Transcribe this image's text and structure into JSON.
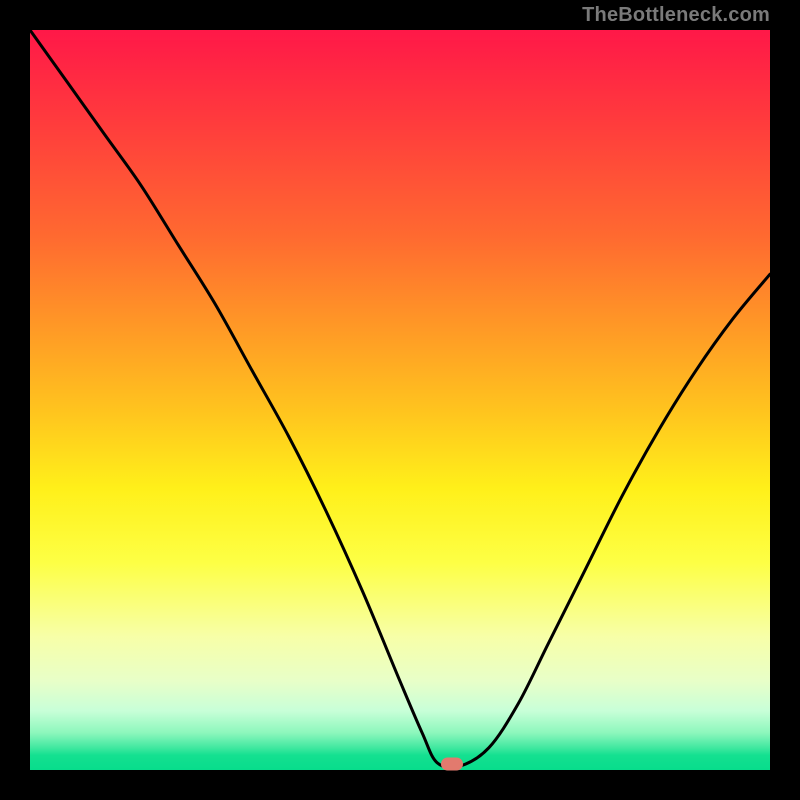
{
  "watermark": "TheBottleneck.com",
  "colors": {
    "curve_stroke": "#000000",
    "marker_fill": "#e27a6e",
    "frame": "#000000"
  },
  "chart_data": {
    "type": "line",
    "title": "",
    "xlabel": "",
    "ylabel": "",
    "xlim": [
      0,
      100
    ],
    "ylim": [
      0,
      100
    ],
    "series": [
      {
        "name": "bottleneck-curve",
        "x": [
          0,
          5,
          10,
          15,
          20,
          25,
          30,
          35,
          40,
          45,
          50,
          53,
          55,
          58,
          62,
          66,
          70,
          75,
          80,
          85,
          90,
          95,
          100
        ],
        "values": [
          100,
          93,
          86,
          79,
          71,
          63,
          54,
          45,
          35,
          24,
          12,
          5,
          1,
          0.5,
          3,
          9,
          17,
          27,
          37,
          46,
          54,
          61,
          67
        ]
      }
    ],
    "marker": {
      "x": 57,
      "y": 0.8
    },
    "gradient_stops": [
      {
        "pct": 0,
        "color": "#ff1848"
      },
      {
        "pct": 12,
        "color": "#ff3a3d"
      },
      {
        "pct": 28,
        "color": "#ff6a30"
      },
      {
        "pct": 40,
        "color": "#ff9826"
      },
      {
        "pct": 52,
        "color": "#ffc61e"
      },
      {
        "pct": 62,
        "color": "#fff01a"
      },
      {
        "pct": 72,
        "color": "#fdff45"
      },
      {
        "pct": 82,
        "color": "#f7ffa8"
      },
      {
        "pct": 88,
        "color": "#e8ffc8"
      },
      {
        "pct": 92,
        "color": "#c8ffd8"
      },
      {
        "pct": 95,
        "color": "#8cf7bc"
      },
      {
        "pct": 97,
        "color": "#40e8a0"
      },
      {
        "pct": 98,
        "color": "#14e090"
      },
      {
        "pct": 100,
        "color": "#08dd8c"
      }
    ]
  }
}
